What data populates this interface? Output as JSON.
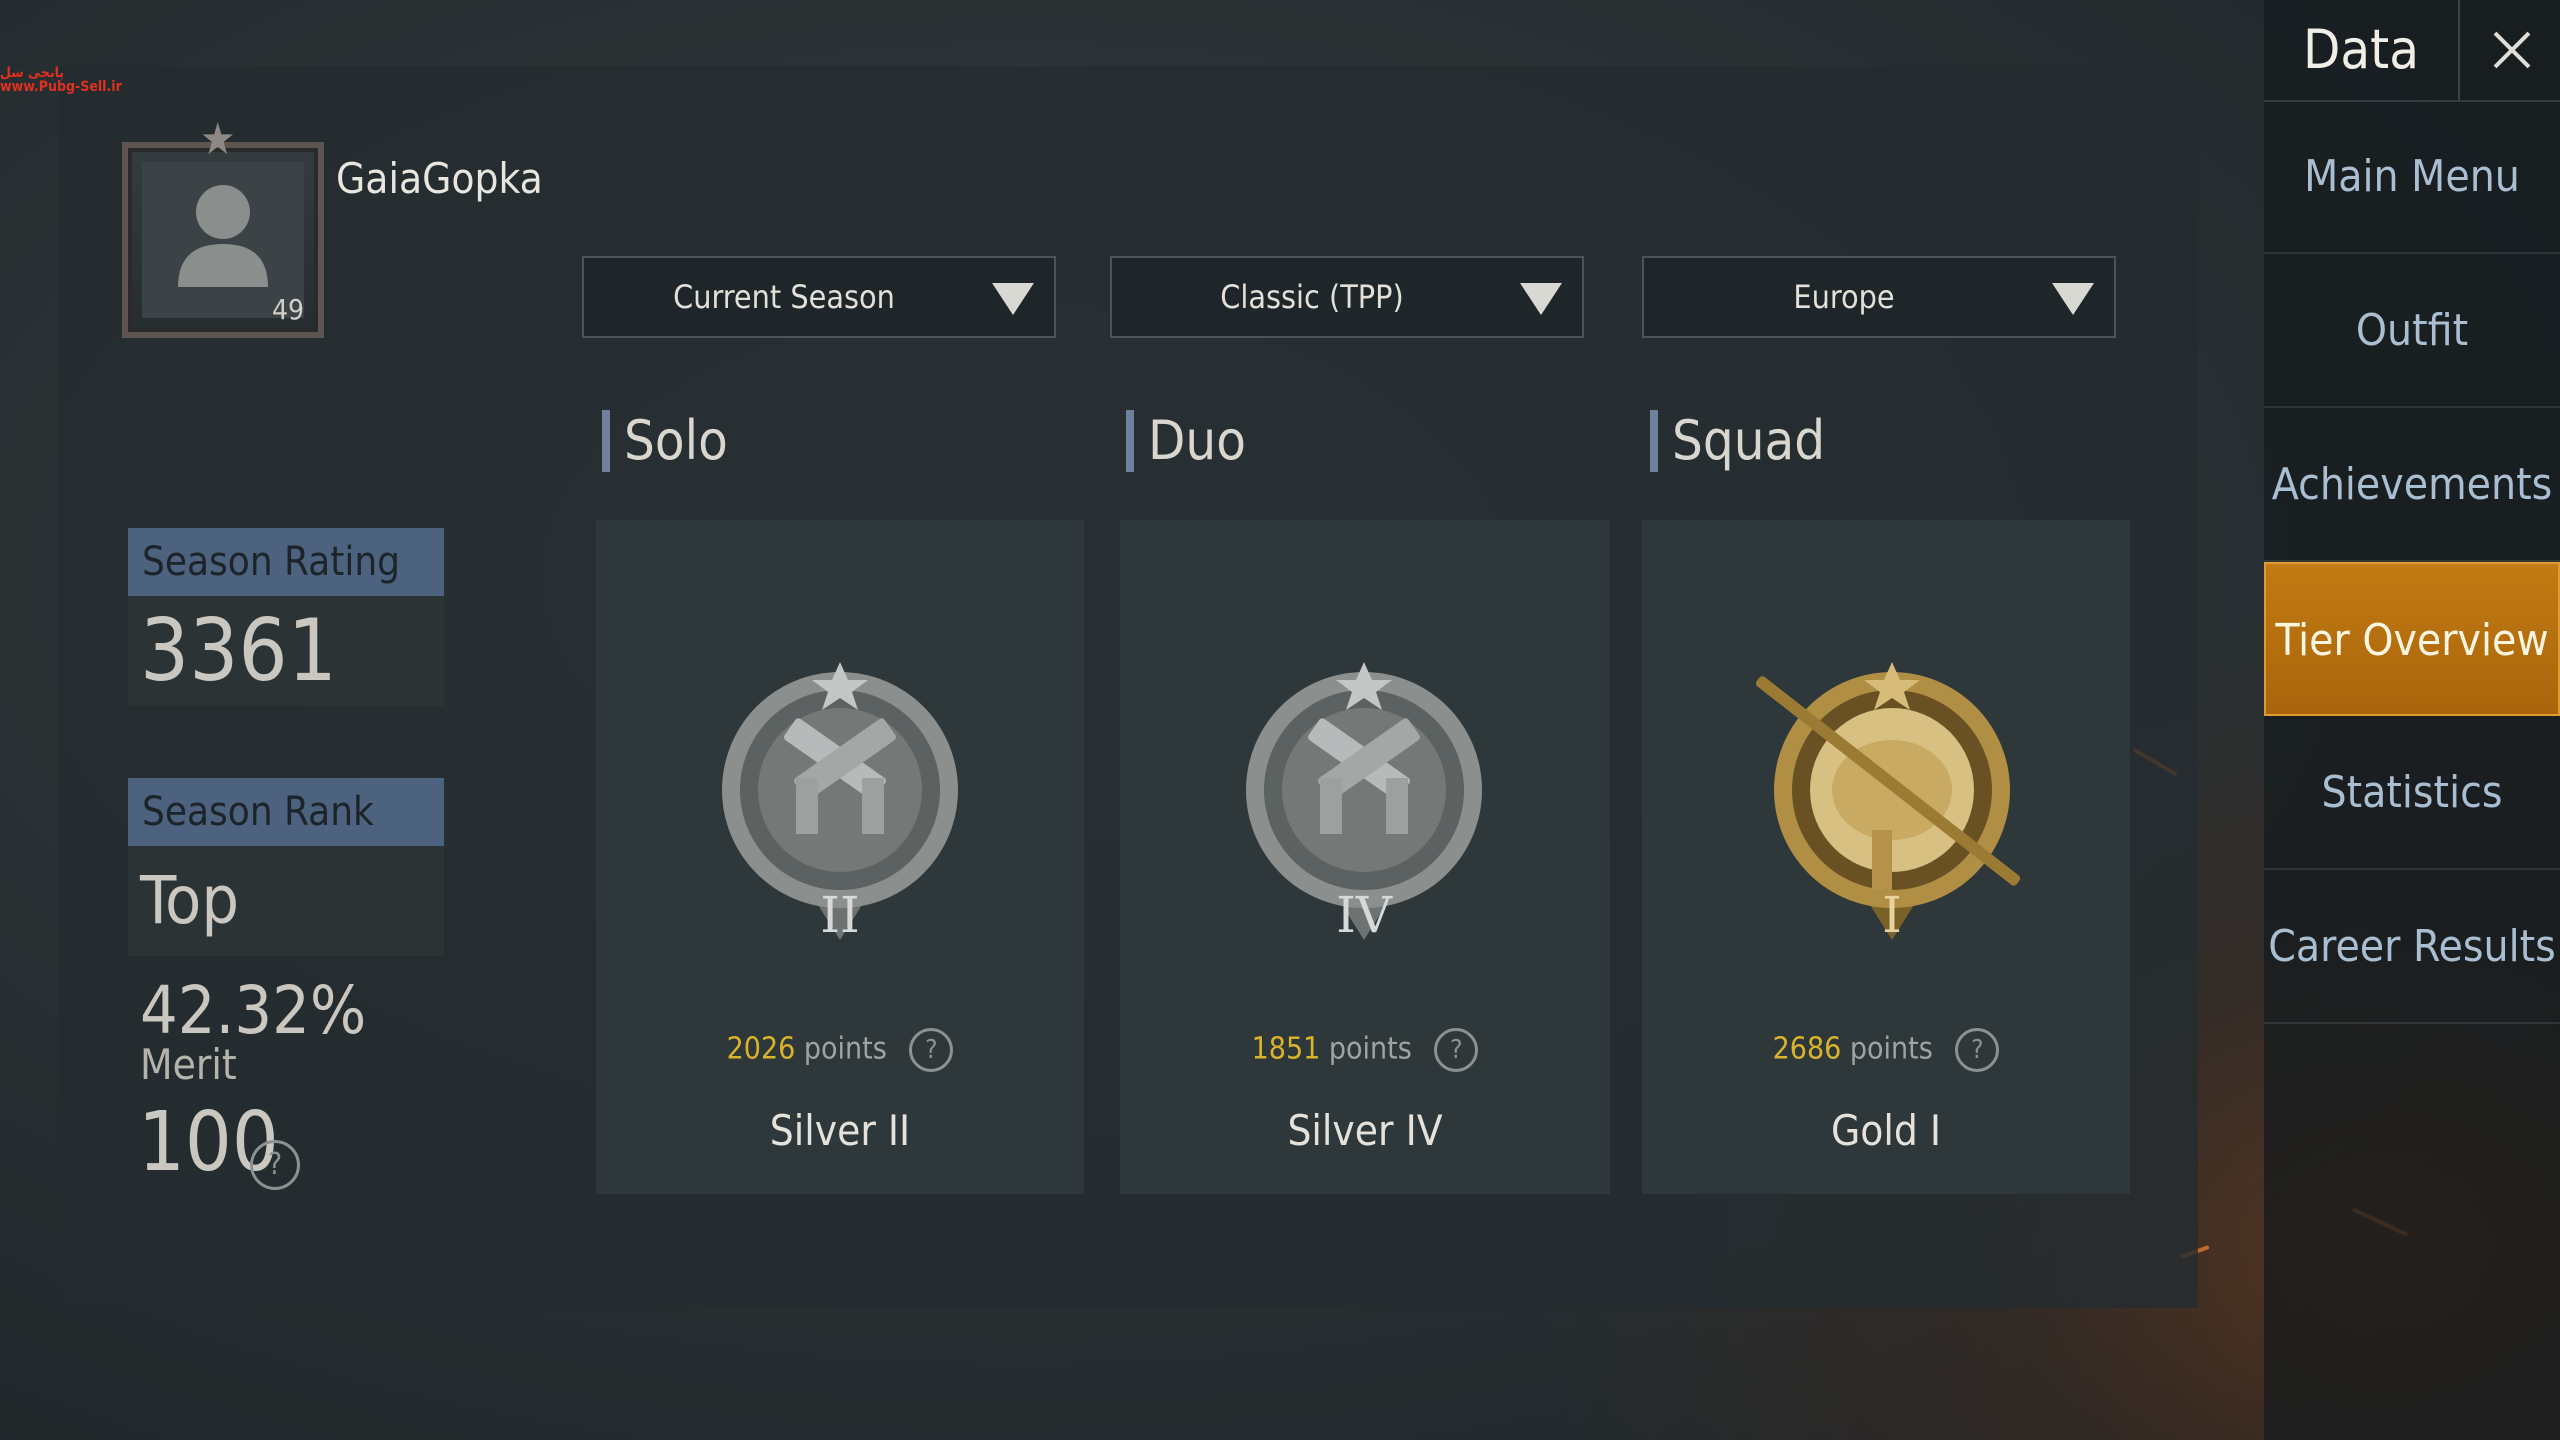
{
  "watermark": "پابجی سل\nwww.Pubg-Sell.ir",
  "profile": {
    "username": "GaiaGopka",
    "level": "49"
  },
  "filters": [
    {
      "label": "Current Season"
    },
    {
      "label": "Classic (TPP)"
    },
    {
      "label": "Europe"
    }
  ],
  "stats": {
    "season_rating_label": "Season Rating",
    "season_rating_value": "3361",
    "season_rank_label": "Season Rank",
    "season_rank_value": "Top 42.32%",
    "merit_label": "Merit",
    "merit_value": "100",
    "help_glyph": "?"
  },
  "modes": [
    {
      "title": "Solo",
      "points": "2026",
      "points_suffix": "points",
      "tier": "Silver II",
      "numeral": "II",
      "medal": "silver"
    },
    {
      "title": "Duo",
      "points": "1851",
      "points_suffix": "points",
      "tier": "Silver IV",
      "numeral": "IV",
      "medal": "silver"
    },
    {
      "title": "Squad",
      "points": "2686",
      "points_suffix": "points",
      "tier": "Gold I",
      "numeral": "I",
      "medal": "gold"
    }
  ],
  "sidebar": {
    "title": "Data",
    "close_icon": "close-icon",
    "items": [
      {
        "label": "Main Menu",
        "active": false
      },
      {
        "label": "Outfit",
        "active": false
      },
      {
        "label": "Achievements",
        "active": false
      },
      {
        "label": "Tier Overview",
        "active": true
      },
      {
        "label": "Statistics",
        "active": false
      },
      {
        "label": "Career Results",
        "active": false
      }
    ]
  },
  "colors": {
    "accent_active": "#c27a12",
    "points_gold": "#d9b32a",
    "label_blue": "#4d627e"
  }
}
